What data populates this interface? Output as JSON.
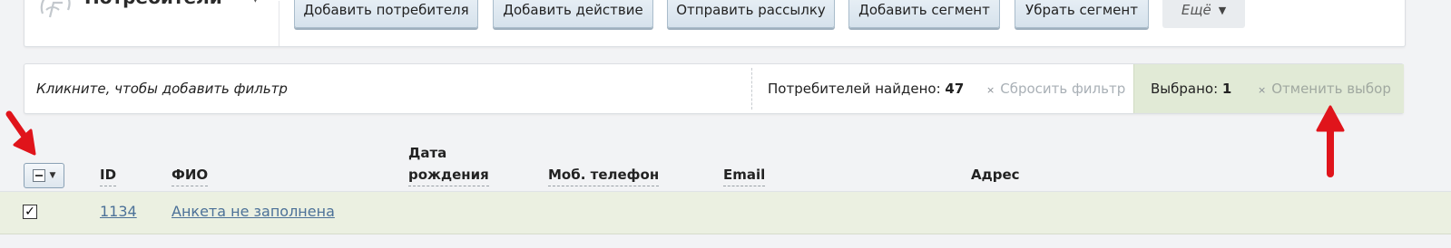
{
  "header": {
    "section_title": "Потребители",
    "title_caret_icon": "caret-down-icon",
    "logo_icon": "app-logo-icon"
  },
  "toolbar": {
    "buttons": [
      {
        "label": "Добавить потребителя"
      },
      {
        "label": "Добавить действие"
      },
      {
        "label": "Отправить рассылку"
      },
      {
        "label": "Добавить сегмент"
      },
      {
        "label": "Убрать сегмент"
      }
    ],
    "more_label": "Ещё",
    "more_icon": "caret-down-icon"
  },
  "filter": {
    "hint": "Кликните, чтобы добавить фильтр",
    "found_label": "Потребителей найдено:",
    "found_count": "47",
    "reset_label": "Сбросить фильтр",
    "selected_label": "Выбрано:",
    "selected_count": "1",
    "deselect_label": "Отменить выбор",
    "close_mark": "×"
  },
  "table": {
    "columns": {
      "id": "ID",
      "name": "ФИО",
      "birth_line1": "Дата",
      "birth_line2": "рождения",
      "phone": "Моб. телефон",
      "email": "Email",
      "address": "Адрес"
    },
    "rows": [
      {
        "checked": true,
        "id": "1134",
        "name": "Анкета не заполнена",
        "birth": "",
        "phone": "",
        "email": "",
        "address": ""
      }
    ]
  },
  "colors": {
    "selected_bg": "#e1ead6",
    "row_selected_bg": "#ebf0e1",
    "link": "#4c7198",
    "annotation_arrow": "#e0141b"
  }
}
